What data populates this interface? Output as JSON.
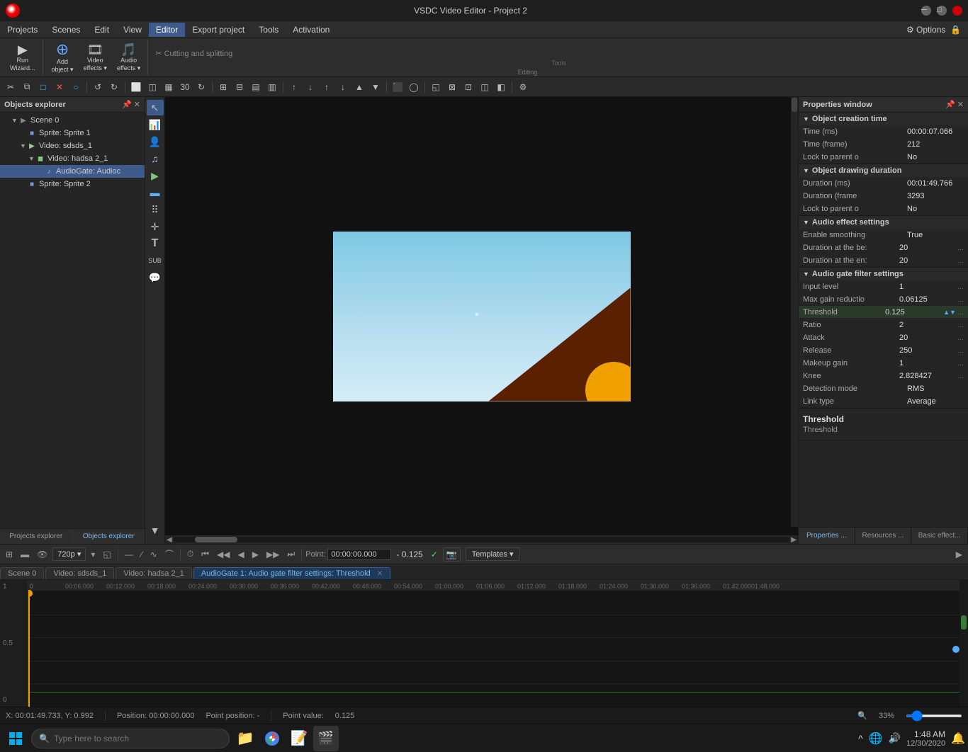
{
  "titlebar": {
    "title": "VSDC Video Editor - Project 2",
    "min_label": "─",
    "max_label": "□",
    "close_label": "✕"
  },
  "menubar": {
    "items": [
      {
        "id": "projects",
        "label": "Projects"
      },
      {
        "id": "scenes",
        "label": "Scenes"
      },
      {
        "id": "edit",
        "label": "Edit"
      },
      {
        "id": "view",
        "label": "View"
      },
      {
        "id": "editor",
        "label": "Editor"
      },
      {
        "id": "export",
        "label": "Export project"
      },
      {
        "id": "tools",
        "label": "Tools"
      },
      {
        "id": "activation",
        "label": "Activation"
      }
    ],
    "options_label": "⚙ Options",
    "active_item": "Editor"
  },
  "toolbar": {
    "groups": [
      {
        "id": "run",
        "items": [
          {
            "id": "run-wizard",
            "icon": "▶",
            "label": "Run\nWizard..."
          }
        ]
      },
      {
        "id": "add",
        "items": [
          {
            "id": "add-object",
            "icon": "⊕",
            "label": "Add\nobject ▾"
          },
          {
            "id": "video-effects",
            "icon": "🎞",
            "label": "Video\neffects ▾"
          },
          {
            "id": "audio-effects",
            "icon": "🎵",
            "label": "Audio\neffects ▾"
          }
        ],
        "section_label": "Editing"
      },
      {
        "id": "tools",
        "items": [
          {
            "id": "cutting",
            "label": "Cutting and splitting",
            "disabled": true
          }
        ],
        "section_label": "Tools"
      }
    ]
  },
  "icon_toolbar": {
    "buttons": [
      "✂",
      "□",
      "□",
      "✕",
      "○",
      "↺",
      "↻",
      "⬜",
      "◫",
      "▦",
      "◻",
      "▷",
      "⊞",
      "⊟",
      "▤",
      "▥",
      "◱",
      "▶",
      "◀",
      "↑",
      "↓",
      "↑",
      "↓",
      "▲",
      "▼",
      "⬛",
      "◯",
      "◱",
      "⊠",
      "⊡",
      "◫",
      "◧",
      "⊕",
      "⚙"
    ]
  },
  "objects_explorer": {
    "title": "Objects explorer",
    "items": [
      {
        "id": "scene0",
        "label": "Scene 0",
        "indent": 0,
        "icon": "▶",
        "icon_type": "scene",
        "expanded": true
      },
      {
        "id": "sprite1",
        "label": "Sprite: Sprite 1",
        "indent": 1,
        "icon": "■",
        "icon_type": "sprite",
        "expanded": false
      },
      {
        "id": "video-sdsds",
        "label": "Video: sdsds_1",
        "indent": 1,
        "icon": "▶",
        "icon_type": "video",
        "expanded": true
      },
      {
        "id": "video-hadsa",
        "label": "Video: hadsa 2_1",
        "indent": 2,
        "icon": "▶",
        "icon_type": "video",
        "expanded": true
      },
      {
        "id": "audiogate",
        "label": "AudioGate: Audioc",
        "indent": 3,
        "icon": "♪",
        "icon_type": "audio",
        "expanded": false,
        "selected": true
      },
      {
        "id": "sprite2",
        "label": "Sprite: Sprite 2",
        "indent": 1,
        "icon": "■",
        "icon_type": "sprite",
        "expanded": false
      }
    ]
  },
  "side_toolbar": {
    "buttons": [
      {
        "id": "cursor",
        "icon": "↖",
        "active": true
      },
      {
        "id": "chart",
        "icon": "📊"
      },
      {
        "id": "person",
        "icon": "👤"
      },
      {
        "id": "music",
        "icon": "♫"
      },
      {
        "id": "play",
        "icon": "▶"
      },
      {
        "id": "rect",
        "icon": "▬"
      },
      {
        "id": "dots",
        "icon": "⠿"
      },
      {
        "id": "move",
        "icon": "✛"
      },
      {
        "id": "text",
        "icon": "T"
      },
      {
        "id": "sub",
        "icon": "sub"
      },
      {
        "id": "bubble",
        "icon": "💬"
      }
    ]
  },
  "properties_window": {
    "title": "Properties window",
    "sections": [
      {
        "id": "object-creation-time",
        "label": "Object creation time",
        "expanded": true,
        "rows": [
          {
            "name": "Time (ms)",
            "value": "00:00:07.066"
          },
          {
            "name": "Time (frame)",
            "value": "212"
          },
          {
            "name": "Lock to parent o",
            "value": "No"
          }
        ]
      },
      {
        "id": "object-drawing-duration",
        "label": "Object drawing duration",
        "expanded": true,
        "rows": [
          {
            "name": "Duration (ms)",
            "value": "00:01:49.766"
          },
          {
            "name": "Duration (frame",
            "value": "3293"
          },
          {
            "name": "Lock to parent o",
            "value": "No"
          }
        ]
      },
      {
        "id": "audio-effect-settings",
        "label": "Audio effect settings",
        "expanded": true,
        "rows": [
          {
            "name": "Enable smoothing",
            "value": "True"
          },
          {
            "name": "Duration at the be:",
            "value": "20",
            "has_edit": true
          },
          {
            "name": "Duration at the en:",
            "value": "20",
            "has_edit": true
          }
        ]
      },
      {
        "id": "audio-gate-filter-settings",
        "label": "Audio gate filter settings",
        "expanded": true,
        "rows": [
          {
            "name": "Input level",
            "value": "1",
            "has_edit": true
          },
          {
            "name": "Max gain reductio",
            "value": "0.06125",
            "has_edit": true
          },
          {
            "name": "Threshold",
            "value": "0.125",
            "has_edit": true
          },
          {
            "name": "Ratio",
            "value": "2",
            "has_edit": true
          },
          {
            "name": "Attack",
            "value": "20",
            "has_edit": true
          },
          {
            "name": "Release",
            "value": "250",
            "has_edit": true
          },
          {
            "name": "Makeup gain",
            "value": "1",
            "has_edit": true
          },
          {
            "name": "Knee",
            "value": "2.828427",
            "has_edit": true
          },
          {
            "name": "Detection mode",
            "value": "RMS"
          },
          {
            "name": "Link type",
            "value": "Average"
          }
        ]
      }
    ],
    "threshold_section": {
      "title": "Threshold",
      "desc": "Threshold"
    },
    "footer_tabs": [
      {
        "id": "properties",
        "label": "Properties ..."
      },
      {
        "id": "resources",
        "label": "Resources ..."
      },
      {
        "id": "basic-effect",
        "label": "Basic effect..."
      }
    ]
  },
  "timeline_controls": {
    "buttons": [
      "⊞",
      "▬",
      "👁",
      "720p ▾",
      "▾",
      "◱",
      "—",
      "∕",
      "∿",
      "⌒"
    ],
    "resolution": "720p",
    "point_label": "Point:",
    "point_value": "00:00:00.000",
    "dash_value": "- 0.125",
    "checkmark": "✓",
    "templates_label": "Templates ▾"
  },
  "timeline_tabs": [
    {
      "id": "scene0",
      "label": "Scene 0"
    },
    {
      "id": "video-sdsds",
      "label": "Video: sdsds_1"
    },
    {
      "id": "video-hadsa",
      "label": "Video: hadsa 2_1"
    },
    {
      "id": "audiogate",
      "label": "AudioGate 1: Audio gate filter settings: Threshold",
      "active": true,
      "closeable": true
    }
  ],
  "timeline_ruler": {
    "marks": [
      "0",
      "00:06.000",
      "00:12.000",
      "00:18.000",
      "00:24.000",
      "00:30.000",
      "00:36.000",
      "00:42.000",
      "00:48.000",
      "00:54.000",
      "01:00.000",
      "01:06.000",
      "01:12.000",
      "01:18.000",
      "01:24.000",
      "01:30.000",
      "01:36.000",
      "01:42.000",
      "01:48.000"
    ]
  },
  "waveform": {
    "labels": [
      "1",
      "0.5",
      "0"
    ]
  },
  "status_bar": {
    "position_label": "X: 00:01:49.733, Y: 0.992",
    "position_time": "Position: 00:00:00.000",
    "point_position": "Point position: -",
    "point_value_label": "Point value:",
    "point_value": "0.125",
    "zoom": "33%"
  },
  "taskbar": {
    "search_placeholder": "Type here to search",
    "time": "1:48 AM",
    "date": "12/30/2020"
  }
}
